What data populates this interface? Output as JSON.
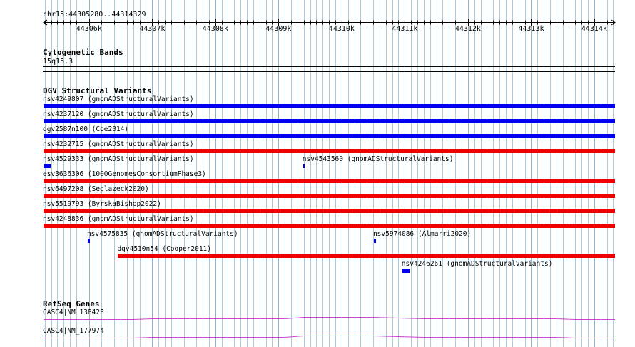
{
  "colors": {
    "grid": "#a8cbd9",
    "gain": "#0000ee",
    "loss": "#ee0000",
    "gene": "#cc44cc",
    "frame": "#000000"
  },
  "region": {
    "label": "chr15:44305280..44314329",
    "start": 44305280,
    "end": 44314329
  },
  "ruler": {
    "ticks": [
      {
        "pos": 44306000,
        "label": "44306k"
      },
      {
        "pos": 44307000,
        "label": "44307k"
      },
      {
        "pos": 44308000,
        "label": "44308k"
      },
      {
        "pos": 44309000,
        "label": "44309k"
      },
      {
        "pos": 44310000,
        "label": "44310k"
      },
      {
        "pos": 44311000,
        "label": "44311k"
      },
      {
        "pos": 44312000,
        "label": "44312k"
      },
      {
        "pos": 44313000,
        "label": "44313k"
      },
      {
        "pos": 44314000,
        "label": "44314k"
      }
    ]
  },
  "cytoband": {
    "title": "Cytogenetic Bands",
    "band": "15q15.3"
  },
  "dgv": {
    "title": "DGV Structural Variants",
    "features": [
      {
        "label": "nsv4249807 (gnomADStructuralVariants)",
        "start": 44305280,
        "end": 44314329,
        "type": "gain",
        "row": 0
      },
      {
        "label": "nsv4237120 (gnomADStructuralVariants)",
        "start": 44305280,
        "end": 44314329,
        "type": "gain",
        "row": 1
      },
      {
        "label": "dgv2587n100 (Coe2014)",
        "start": 44305280,
        "end": 44314329,
        "type": "gain",
        "row": 2
      },
      {
        "label": "nsv4232715 (gnomADStructuralVariants)",
        "start": 44305280,
        "end": 44314329,
        "type": "loss",
        "row": 3
      },
      {
        "label": "nsv4529333 (gnomADStructuralVariants)",
        "start": 44305280,
        "end": 44305390,
        "type": "gain",
        "row": 4
      },
      {
        "label": "nsv4543560 (gnomADStructuralVariants)",
        "start": 44309390,
        "end": 44309420,
        "type": "gain",
        "row": 4
      },
      {
        "label": "esv3636306 (1000GenomesConsortiumPhase3)",
        "start": 44305280,
        "end": 44314329,
        "type": "loss",
        "row": 5
      },
      {
        "label": "nsv6497208 (Sedlazeck2020)",
        "start": 44305280,
        "end": 44314329,
        "type": "loss",
        "row": 6
      },
      {
        "label": "nsv5519793 (ByrskaBishop2022)",
        "start": 44305280,
        "end": 44314329,
        "type": "loss",
        "row": 7
      },
      {
        "label": "nsv4248836 (gnomADStructuralVariants)",
        "start": 44305280,
        "end": 44314329,
        "type": "loss",
        "row": 8
      },
      {
        "label": "nsv4575835 (gnomADStructuralVariants)",
        "start": 44305980,
        "end": 44306010,
        "type": "gain",
        "row": 9
      },
      {
        "label": "nsv5974086 (Almarri2020)",
        "start": 44310510,
        "end": 44310540,
        "type": "gain",
        "row": 9
      },
      {
        "label": "dgv4510n54 (Cooper2011)",
        "start": 44306460,
        "end": 44314329,
        "type": "loss",
        "row": 10
      },
      {
        "label": "nsv4246261 (gnomADStructuralVariants)",
        "start": 44310960,
        "end": 44311080,
        "type": "gain",
        "row": 11
      }
    ]
  },
  "refseq": {
    "title": "RefSeq Genes",
    "genes": [
      {
        "label": "CASC4|NM_138423"
      },
      {
        "label": "CASC4|NM_177974"
      }
    ]
  }
}
